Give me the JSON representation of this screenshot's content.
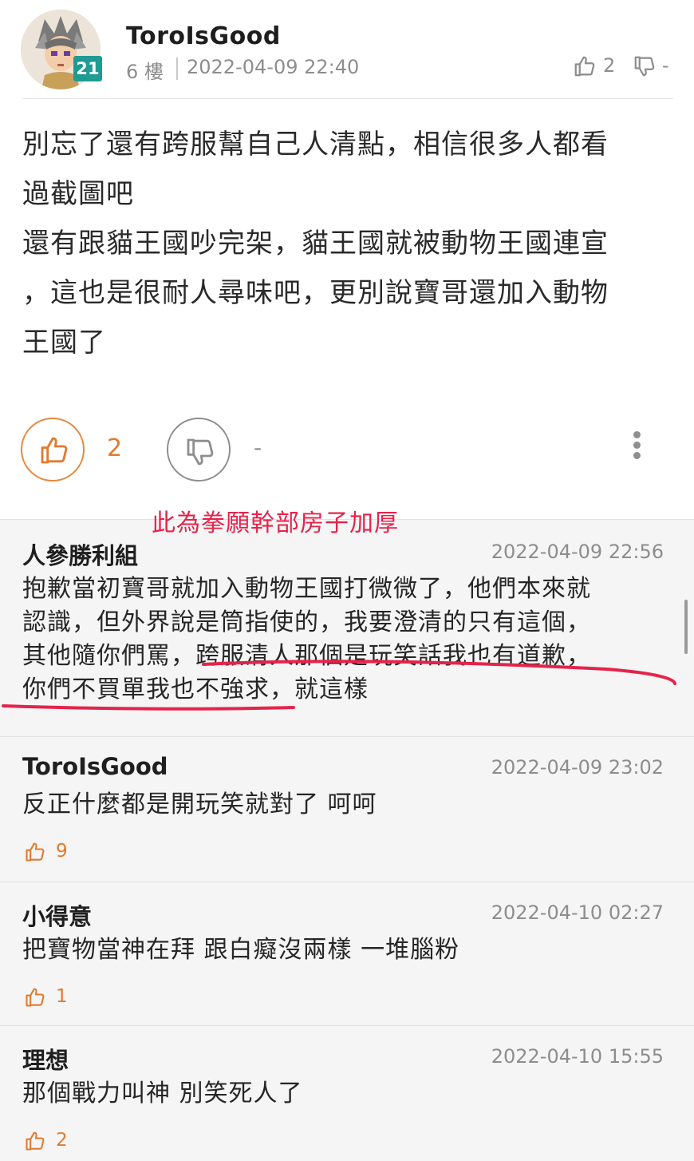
{
  "post": {
    "author": "ToroIsGood",
    "level": "21",
    "floor": "6 樓",
    "time": "2022-04-09 22:40",
    "header_like_count": "2",
    "header_dislike_count": "-",
    "body_lines": [
      "別忘了還有跨服幫自己人清點，相信很多人都看",
      "過截圖吧",
      "還有跟貓王國吵完架，貓王國就被動物王國連宣",
      "，這也是很耐人尋味吧，更別說寶哥還加入動物",
      "王國了"
    ],
    "like_count": "2",
    "dislike_count": "-"
  },
  "annotation": "此為拳願幹部房子加厚",
  "comments": [
    {
      "name": "人參勝利組",
      "time": "2022-04-09 22:56",
      "lines": [
        "抱歉當初寶哥就加入動物王國打微微了，他們本來就",
        "認識，但外界說是筒指使的，我要澄清的只有這個，",
        "其他隨你們罵，跨服清人那個是玩笑話我也有道歉，",
        "你們不買單我也不強求，就這樣"
      ]
    },
    {
      "name": "ToroIsGood",
      "time": "2022-04-09 23:02",
      "lines": [
        "反正什麼都是開玩笑就對了 呵呵"
      ],
      "likes": "9"
    },
    {
      "name": "小得意",
      "time": "2022-04-10 02:27",
      "lines": [
        "把寶物當神在拜 跟白癡沒兩樣 一堆腦粉"
      ],
      "likes": "1"
    },
    {
      "name": "理想",
      "time": "2022-04-10 15:55",
      "lines": [
        "那個戰力叫神 別笑死人了"
      ],
      "likes": "2"
    }
  ],
  "colors": {
    "accent_orange": "#e07b2f",
    "badge_teal": "#1e9b93",
    "annotation_red": "#e5234a"
  },
  "icons": [
    "thumbs-up-icon",
    "thumbs-down-icon",
    "more-vertical-icon"
  ]
}
